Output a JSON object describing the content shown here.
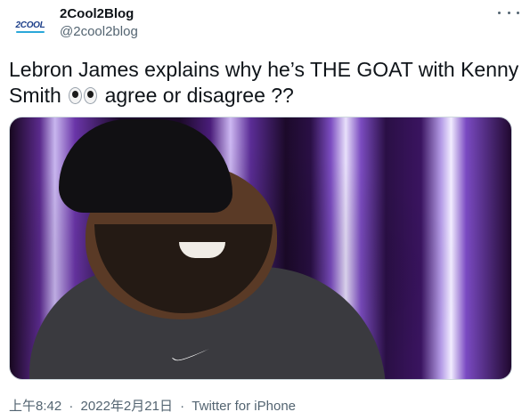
{
  "author": {
    "display_name": "2Cool2Blog",
    "handle": "@2cool2blog",
    "avatar_text": "2COOL"
  },
  "tweet": {
    "text_before_emoji": "Lebron James explains why he’s THE GOAT with Kenny Smith",
    "emoji": "eyes-emoji",
    "text_after_emoji": "agree or disagree ??"
  },
  "meta": {
    "time": "上午8:42",
    "separator": "·",
    "date": "2022年2月21日",
    "source": "Twitter for iPhone"
  },
  "colors": {
    "text_primary": "#0f1419",
    "text_secondary": "#536471",
    "border": "#cfd9de",
    "media_accent": "#7b4cc0"
  }
}
